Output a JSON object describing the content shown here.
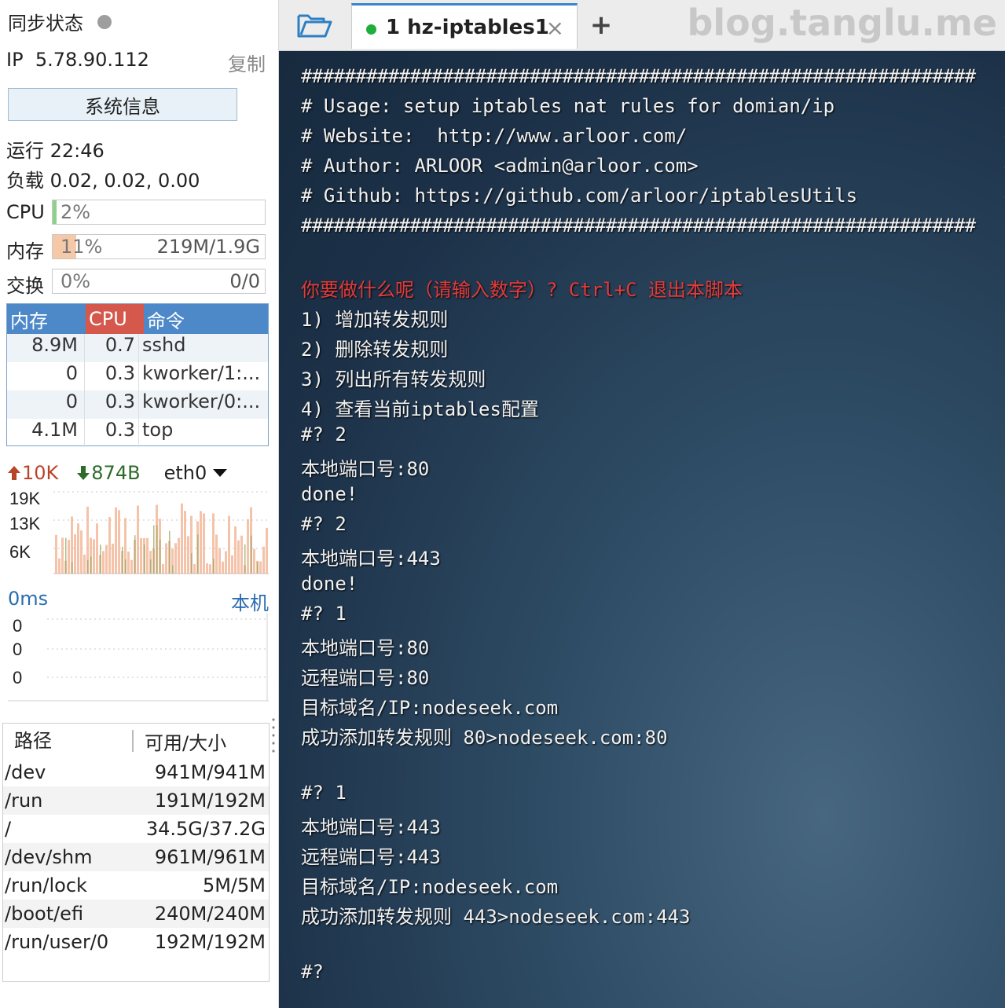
{
  "sidebar": {
    "sync_label": "同步状态",
    "ip_label": "IP",
    "ip_value": "5.78.90.112",
    "copy_label": "复制",
    "sysinfo_button": "系统信息",
    "uptime": "运行 22:46",
    "load": "负载 0.02, 0.02, 0.00",
    "cpu": {
      "label": "CPU",
      "percent": "2%",
      "fill": 0.02
    },
    "mem": {
      "label": "内存",
      "percent": "11%",
      "amount": "219M/1.9G",
      "fill": 0.11
    },
    "swap": {
      "label": "交换",
      "percent": "0%",
      "amount": "0/0",
      "fill": 0
    },
    "proc_table": {
      "headers": [
        "内存",
        "CPU",
        "命令"
      ],
      "rows": [
        {
          "mem": "8.9M",
          "cpu": "0.7",
          "cmd": "sshd"
        },
        {
          "mem": "0",
          "cpu": "0.3",
          "cmd": "kworker/1:..."
        },
        {
          "mem": "0",
          "cpu": "0.3",
          "cmd": "kworker/0:..."
        },
        {
          "mem": "4.1M",
          "cpu": "0.3",
          "cmd": "top"
        }
      ]
    },
    "net": {
      "up": "10K",
      "down": "874B",
      "iface": "eth0",
      "y_ticks": [
        "19K",
        "13K",
        "6K"
      ]
    },
    "ping": {
      "latency": "0ms",
      "target": "本机",
      "values": [
        "0",
        "0",
        "0"
      ]
    },
    "disk_table": {
      "headers": [
        "路径",
        "可用/大小"
      ],
      "rows": [
        {
          "path": "/dev",
          "size": "941M/941M"
        },
        {
          "path": "/run",
          "size": "191M/192M"
        },
        {
          "path": "/",
          "size": "34.5G/37.2G"
        },
        {
          "path": "/dev/shm",
          "size": "961M/961M"
        },
        {
          "path": "/run/lock",
          "size": "5M/5M"
        },
        {
          "path": "/boot/efi",
          "size": "240M/240M"
        },
        {
          "path": "/run/user/0",
          "size": "192M/192M"
        }
      ]
    }
  },
  "tabs": {
    "active_tab": "1  hz-iptables1",
    "close_glyph": "×",
    "add_glyph": "+"
  },
  "watermark": "blog.tanglu.me",
  "colors": {
    "accent_blue": "#4d88c9",
    "cpu_header_red": "#d4584c",
    "prompt_red": "#e43b3b",
    "tab_green": "#1eae3c"
  },
  "terminal": {
    "lines": [
      {
        "text": "##############################################################",
        "style": "hash"
      },
      {
        "text": "# Usage: setup iptables nat rules for domian/ip               #",
        "style": "normal"
      },
      {
        "text": "# Website:  http://www.arloor.com/                            #",
        "style": "normal"
      },
      {
        "text": "# Author: ARLOOR <admin@arloor.com>                           #",
        "style": "normal"
      },
      {
        "text": "# Github: https://github.com/arloor/iptablesUtils             #",
        "style": "normal"
      },
      {
        "text": "##############################################################",
        "style": "hash"
      },
      {
        "text": "",
        "style": "normal"
      },
      {
        "text": "你要做什么呢（请输入数字）? Ctrl+C 退出本脚本",
        "style": "red"
      },
      {
        "text": "1) 增加转发规则",
        "style": "normal"
      },
      {
        "text": "2) 删除转发规则",
        "style": "normal"
      },
      {
        "text": "3) 列出所有转发规则",
        "style": "normal"
      },
      {
        "text": "4) 查看当前iptables配置",
        "style": "normal"
      },
      {
        "text": "#? 2",
        "style": "normal"
      },
      {
        "text": "本地端口号:80",
        "style": "normal"
      },
      {
        "text": "done!",
        "style": "normal"
      },
      {
        "text": "#? 2",
        "style": "normal"
      },
      {
        "text": "本地端口号:443",
        "style": "normal"
      },
      {
        "text": "done!",
        "style": "normal"
      },
      {
        "text": "#? 1",
        "style": "normal"
      },
      {
        "text": "本地端口号:80",
        "style": "normal"
      },
      {
        "text": "远程端口号:80",
        "style": "normal"
      },
      {
        "text": "目标域名/IP:nodeseek.com",
        "style": "normal"
      },
      {
        "text": "成功添加转发规则 80>nodeseek.com:80",
        "style": "normal"
      },
      {
        "text": "",
        "style": "normal"
      },
      {
        "text": "#? 1",
        "style": "normal"
      },
      {
        "text": "本地端口号:443",
        "style": "normal"
      },
      {
        "text": "远程端口号:443",
        "style": "normal"
      },
      {
        "text": "目标域名/IP:nodeseek.com",
        "style": "normal"
      },
      {
        "text": "成功添加转发规则 443>nodeseek.com:443",
        "style": "normal"
      },
      {
        "text": "",
        "style": "normal"
      },
      {
        "text": "#?",
        "style": "normal"
      }
    ]
  }
}
